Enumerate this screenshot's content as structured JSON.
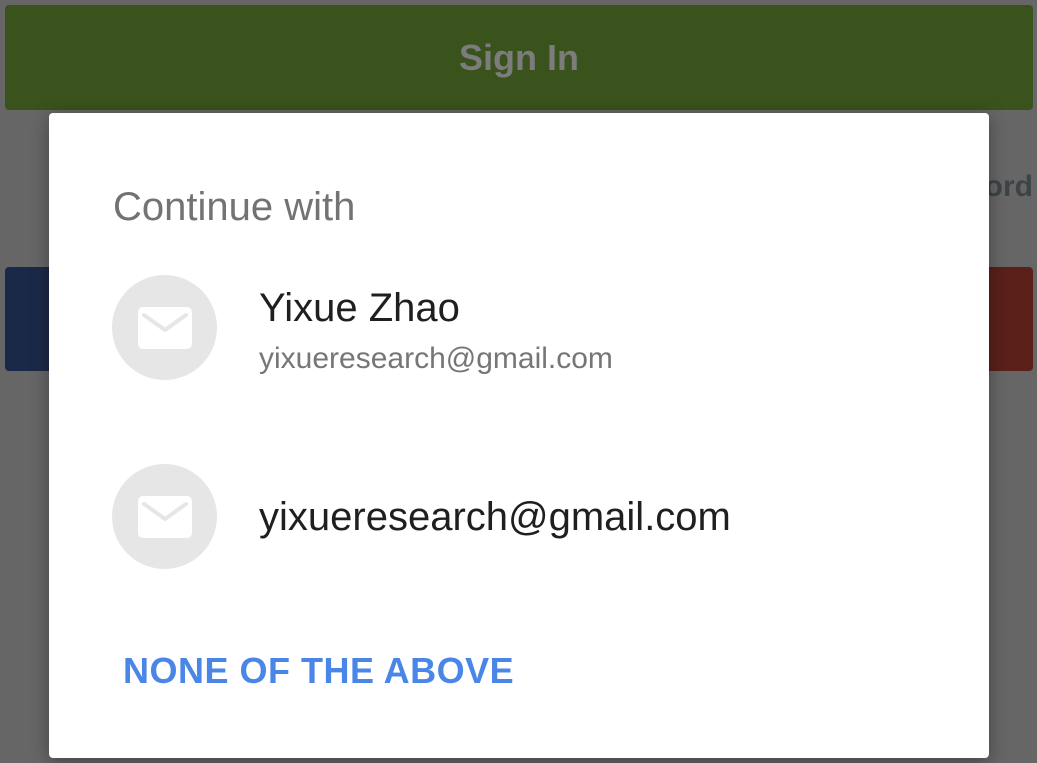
{
  "background": {
    "signin_label": "Sign In",
    "partial_text_right": "ord"
  },
  "dialog": {
    "title": "Continue with",
    "accounts": [
      {
        "name": "Yixue Zhao",
        "email": "yixueresearch@gmail.com",
        "icon": "mail-icon"
      },
      {
        "email": "yixueresearch@gmail.com",
        "icon": "mail-icon"
      }
    ],
    "none_label": "NONE OF THE ABOVE"
  },
  "colors": {
    "accent": "#4a86e8",
    "signin_bg": "#3a521c",
    "avatar_bg": "#e6e6e6"
  }
}
